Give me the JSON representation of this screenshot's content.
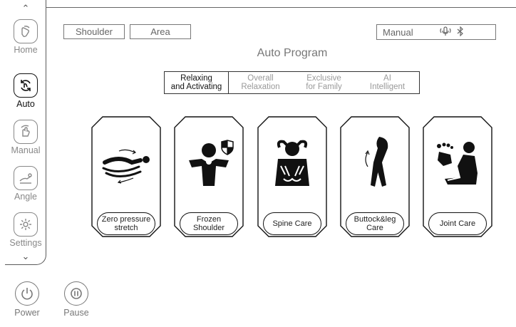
{
  "sidebar": {
    "items": [
      {
        "label": "Home",
        "icon": "hand-press-icon",
        "active": false
      },
      {
        "label": "Auto",
        "icon": "auto-cycle-icon",
        "active": true
      },
      {
        "label": "Manual",
        "icon": "hand-touch-icon",
        "active": false
      },
      {
        "label": "Angle",
        "icon": "recline-angle-icon",
        "active": false
      },
      {
        "label": "Settings",
        "icon": "gear-icon",
        "active": false
      }
    ]
  },
  "bottom": {
    "power_label": "Power",
    "pause_label": "Pause"
  },
  "header": {
    "shoulder_label": "Shoulder",
    "area_label": "Area",
    "mode_label": "Manual",
    "title": "Auto Program"
  },
  "tabs": [
    {
      "label": "Relaxing\nand Activating",
      "active": true
    },
    {
      "label": "Overall\nRelaxation",
      "active": false
    },
    {
      "label": "Exclusive\nfor Family",
      "active": false
    },
    {
      "label": "AI\nIntelligent",
      "active": false
    }
  ],
  "programs": [
    {
      "label": "Zero pressure\nstretch",
      "icon": "zero-gravity-stretch-icon"
    },
    {
      "label": "Frozen\nShoulder",
      "icon": "frozen-shoulder-icon"
    },
    {
      "label": "Spine Care",
      "icon": "spine-care-icon"
    },
    {
      "label": "Buttock&leg\nCare",
      "icon": "buttock-leg-icon"
    },
    {
      "label": "Joint Care",
      "icon": "joint-care-icon"
    }
  ]
}
